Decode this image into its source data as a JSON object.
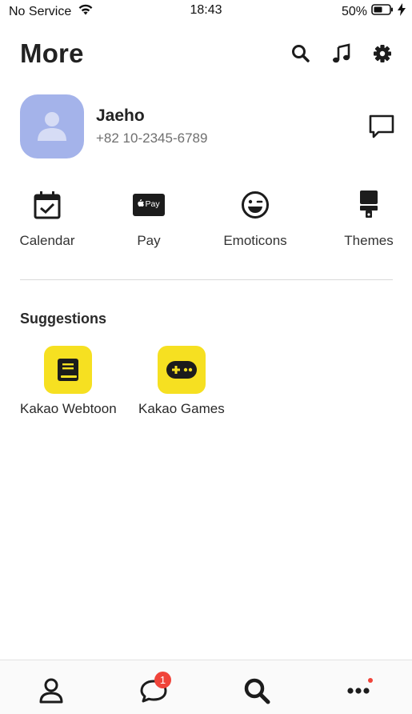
{
  "status_bar": {
    "carrier": "No Service",
    "time": "18:43",
    "battery": "50%"
  },
  "header": {
    "title": "More"
  },
  "profile": {
    "name": "Jaeho",
    "phone": "+82 10-2345-6789"
  },
  "quick_menu": [
    {
      "label": "Calendar",
      "icon": "calendar-icon"
    },
    {
      "label": "Pay",
      "icon": "apple-pay-icon",
      "icon_text": "Pay"
    },
    {
      "label": "Emoticons",
      "icon": "emoticon-icon"
    },
    {
      "label": "Themes",
      "icon": "paint-brush-icon"
    }
  ],
  "suggestions": {
    "title": "Suggestions",
    "items": [
      {
        "label": "Kakao Webtoon",
        "icon": "book-icon"
      },
      {
        "label": "Kakao Games",
        "icon": "gamepad-icon"
      }
    ]
  },
  "tab_bar": {
    "chats_badge": "1",
    "tabs": [
      "friends",
      "chats",
      "search",
      "more"
    ]
  },
  "colors": {
    "avatar_bg": "#a4b3ea",
    "suggest_bg": "#f6e021",
    "badge": "#f0443a"
  }
}
